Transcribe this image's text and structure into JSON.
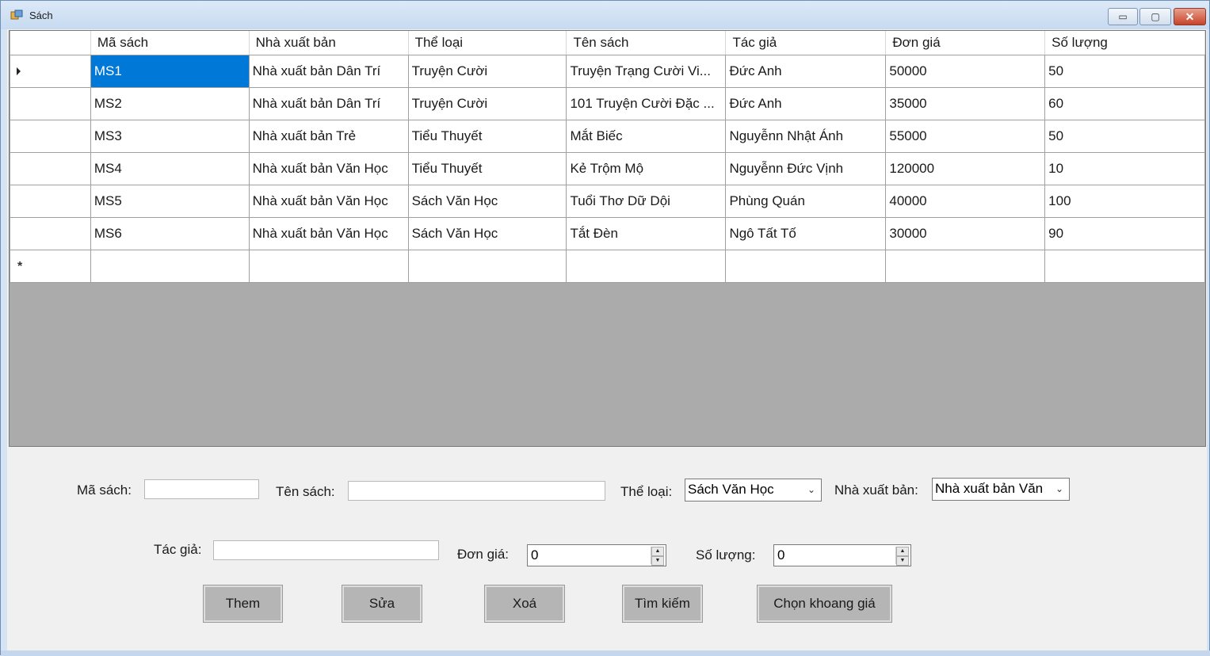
{
  "window": {
    "title": "Sách",
    "controls": {
      "minimize": "▭",
      "maximize": "▢",
      "close": "✕"
    }
  },
  "grid": {
    "columns": [
      "Mã sách",
      "Nhà xuất bản",
      "Thể loại",
      "Tên sách",
      "Tác giả",
      "Đơn giá",
      "Số lượng"
    ],
    "rows": [
      [
        "MS1",
        "Nhà xuất bản Dân Trí",
        "Truyện Cười",
        "Truyện Trạng Cười Vi...",
        "Đức Anh",
        "50000",
        "50"
      ],
      [
        "MS2",
        "Nhà xuất bản Dân Trí",
        "Truyện Cười",
        "101 Truyện Cười Đặc ...",
        "Đức Anh",
        "35000",
        "60"
      ],
      [
        "MS3",
        "Nhà xuất bản Trẻ",
        "Tiểu Thuyết",
        "Mắt Biếc",
        "Nguyễnn Nhật Ánh",
        "55000",
        "50"
      ],
      [
        "MS4",
        "Nhà xuất bản Văn Học",
        "Tiểu Thuyết",
        "Kẻ Trộm Mộ",
        "Nguyễnn Đức Vịnh",
        "120000",
        "10"
      ],
      [
        "MS5",
        "Nhà xuất bản Văn Học",
        "Sách Văn Học",
        "Tuổi Thơ Dữ Dội",
        "Phùng Quán",
        "40000",
        "100"
      ],
      [
        "MS6",
        "Nhà xuất bản Văn Học",
        "Sách Văn Học",
        "Tắt Đèn",
        "Ngô Tất Tố",
        "30000",
        "90"
      ]
    ],
    "new_row_marker": "*",
    "selected_cell": "MS1"
  },
  "form": {
    "ma_sach_label": "Mã sách:",
    "ma_sach_value": "",
    "ten_sach_label": "Tên sách:",
    "ten_sach_value": "",
    "the_loai_label": "Thể loại:",
    "the_loai_value": "Sách Văn Học",
    "nha_xuat_ban_label": "Nhà xuất bản:",
    "nha_xuat_ban_value": "Nhà xuất bản Văn",
    "tac_gia_label": "Tác giả:",
    "tac_gia_value": "",
    "don_gia_label": "Đơn giá:",
    "don_gia_value": "0",
    "so_luong_label": "Số lượng:",
    "so_luong_value": "0"
  },
  "buttons": {
    "them": "Them",
    "sua": "Sửa",
    "xoa": "Xoá",
    "tim_kiem": "Tìm kiếm",
    "chon_khoang_gia": "Chọn khoang giá"
  },
  "colors": {
    "selection": "#0078d7",
    "grid_background": "#ababab",
    "button_face": "#b5b5b5"
  }
}
